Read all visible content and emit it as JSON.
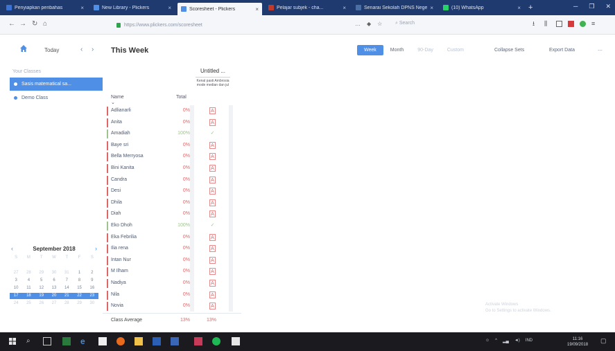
{
  "browser": {
    "tabs": [
      {
        "label": "Penyiapkan peribahas",
        "active": false,
        "fav_color": "#3b73d4"
      },
      {
        "label": "New Library - Plickers",
        "active": false,
        "fav_color": "#4f8fe6"
      },
      {
        "label": "Scoresheet - Plickers",
        "active": true,
        "fav_color": "#4f8fe6"
      },
      {
        "label": "Pelajar subjek - cha...",
        "active": false,
        "fav_color": "#c0392b"
      },
      {
        "label": "Senarai Sekolah DPNS Negeri",
        "active": false,
        "fav_color": "#4a6fa5"
      },
      {
        "label": "(10) WhatsApp",
        "active": false,
        "fav_color": "#25d366"
      }
    ],
    "url": "https://www.plickers.com/scoresheet",
    "search_placeholder": "Search"
  },
  "header": {
    "today": "Today",
    "title": "This Week",
    "views": [
      {
        "label": "Week",
        "state": "on"
      },
      {
        "label": "Month",
        "state": "normal"
      },
      {
        "label": "90-Day",
        "state": "muted"
      },
      {
        "label": "Custom",
        "state": "muted"
      }
    ],
    "collapse_sets": "Collapse Sets",
    "export_data": "Export Data"
  },
  "sidebar": {
    "section": "Your Classes",
    "classes": [
      {
        "label": "Sasis matematical sa...",
        "selected": true
      },
      {
        "label": "Demo Class",
        "selected": false
      }
    ]
  },
  "calendar": {
    "month": "September 2018",
    "days": [
      [
        "S",
        "M",
        "T",
        "W",
        "T",
        "F",
        "S"
      ],
      [
        "",
        "",
        "",
        "",
        "",
        "",
        ""
      ],
      [
        "27",
        "28",
        "29",
        "30",
        "31",
        "1",
        "2"
      ],
      [
        "3",
        "4",
        "5",
        "6",
        "7",
        "8",
        "9"
      ],
      [
        "10",
        "11",
        "12",
        "13",
        "14",
        "15",
        "16"
      ],
      [
        "17",
        "18",
        "19",
        "20",
        "21",
        "22",
        "23"
      ],
      [
        "24",
        "25",
        "26",
        "27",
        "28",
        "29",
        "30"
      ]
    ],
    "selected_week_row": 5
  },
  "scoresheet": {
    "column_title": "Untitled ...",
    "column_subtitle": "Kenal pasti Ambrosia mode median dan jul",
    "name_header": "Name",
    "total_header": "Total",
    "students": [
      {
        "name": "Adlianarli",
        "total": "0%",
        "result": "wrong"
      },
      {
        "name": "Anita",
        "total": "0%",
        "result": "wrong"
      },
      {
        "name": "Amadiah",
        "total": "100%",
        "result": "right"
      },
      {
        "name": "Baye sri",
        "total": "0%",
        "result": "wrong"
      },
      {
        "name": "Bella Merryosa",
        "total": "0%",
        "result": "wrong"
      },
      {
        "name": "Bini Kanita",
        "total": "0%",
        "result": "wrong"
      },
      {
        "name": "Candra",
        "total": "0%",
        "result": "wrong"
      },
      {
        "name": "Desi",
        "total": "0%",
        "result": "wrong"
      },
      {
        "name": "Dhila",
        "total": "0%",
        "result": "wrong"
      },
      {
        "name": "Diah",
        "total": "0%",
        "result": "wrong"
      },
      {
        "name": "Eko Dhoh",
        "total": "100%",
        "result": "right"
      },
      {
        "name": "Eka Febrilia",
        "total": "0%",
        "result": "wrong"
      },
      {
        "name": "Ilia rena",
        "total": "0%",
        "result": "wrong"
      },
      {
        "name": "Intan Nur",
        "total": "0%",
        "result": "wrong"
      },
      {
        "name": "M Ilham",
        "total": "0%",
        "result": "wrong"
      },
      {
        "name": "Nadiya",
        "total": "0%",
        "result": "wrong"
      },
      {
        "name": "Nila",
        "total": "0%",
        "result": "wrong"
      },
      {
        "name": "Novia",
        "total": "0%",
        "result": "wrong"
      }
    ],
    "class_average_label": "Class Average",
    "class_average_total": "13%",
    "class_average_assignment": "13%"
  },
  "watermark": {
    "line1": "Activate Windows",
    "line2": "Go to Settings to activate Windows."
  },
  "taskbar": {
    "time": "11:16",
    "date": "19/09/2018",
    "lang": "IND"
  },
  "colors": {
    "accent": "#4f8fe6",
    "wrong": "#e06565",
    "right": "#9dc48c",
    "tabstrip": "#1f3a6e",
    "taskbar": "#1a1a1f"
  }
}
